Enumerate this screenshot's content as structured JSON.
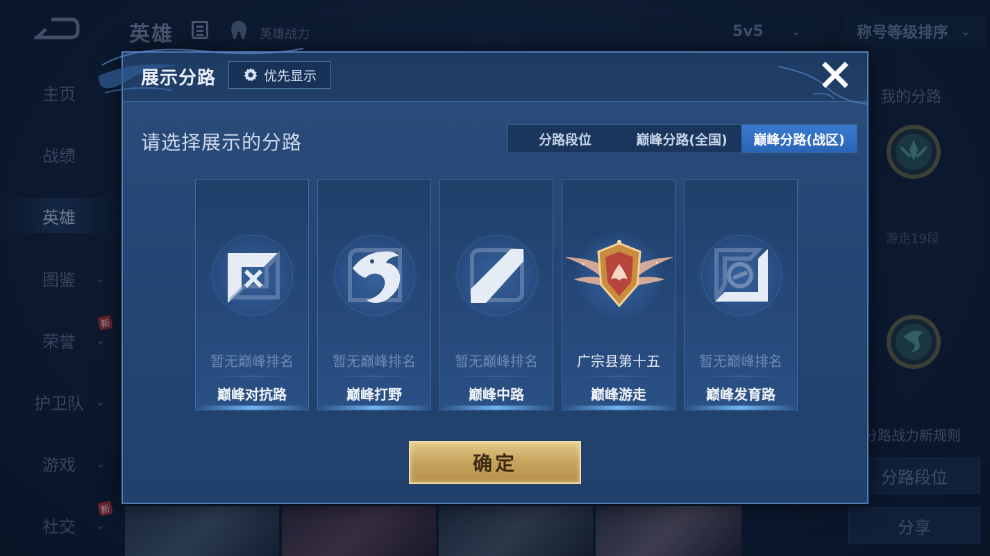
{
  "background": {
    "title": "英雄",
    "subtitle": "英雄战力",
    "mode_select": "5v5",
    "sort_select": "称号等级排序",
    "nav": [
      "主页",
      "战绩",
      "英雄",
      "图鉴",
      "荣誉",
      "护卫队",
      "游戏",
      "社交"
    ],
    "new_badge": "新",
    "right_panel": {
      "my_lane_label": "我的分路",
      "tier_text": "游走19段",
      "rule_text": "分路战力新规则",
      "lane_rank_button": "分路段位",
      "share_button": "分享"
    }
  },
  "modal": {
    "title": "展示分路",
    "priority_button": "优先显示",
    "prompt": "请选择展示的分路",
    "tabs": [
      "分路段位",
      "巅峰分路(全国)",
      "巅峰分路(战区)"
    ],
    "active_tab": "巅峰分路(战区)",
    "cards": [
      {
        "rank": "暂无巅峰排名",
        "lane": "巅峰对抗路",
        "icon": "clash-lane-icon",
        "has_rank": false
      },
      {
        "rank": "暂无巅峰排名",
        "lane": "巅峰打野",
        "icon": "jungle-dragon-icon",
        "has_rank": false
      },
      {
        "rank": "暂无巅峰排名",
        "lane": "巅峰中路",
        "icon": "mid-lane-icon",
        "has_rank": false
      },
      {
        "rank": "广宗县第十五",
        "lane": "巅峰游走",
        "icon": "roam-winged-badge-icon",
        "has_rank": true
      },
      {
        "rank": "暂无巅峰排名",
        "lane": "巅峰发育路",
        "icon": "farm-lane-icon",
        "has_rank": false
      }
    ],
    "confirm_button": "确定"
  }
}
